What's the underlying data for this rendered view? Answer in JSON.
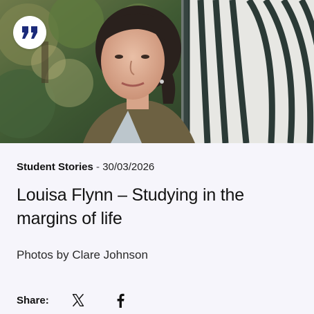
{
  "article": {
    "category": "Student Stories",
    "separator": " - ",
    "date": "30/03/2026",
    "title": "Louisa Flynn – Studying in the margins of life",
    "photo_credit": "Photos by Clare Johnson"
  },
  "share": {
    "label": "Share:",
    "buttons": [
      {
        "icon": "x-twitter-icon"
      },
      {
        "icon": "facebook-icon"
      }
    ]
  },
  "hero": {
    "badge_icon": "quote-icon",
    "badge_color": "#1b2a7a"
  }
}
